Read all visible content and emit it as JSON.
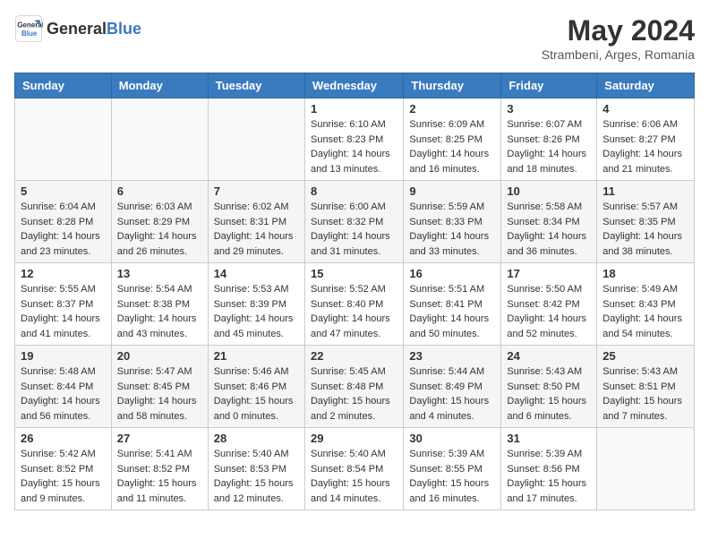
{
  "logo": {
    "text_general": "General",
    "text_blue": "Blue"
  },
  "header": {
    "month_year": "May 2024",
    "location": "Strambeni, Arges, Romania"
  },
  "weekdays": [
    "Sunday",
    "Monday",
    "Tuesday",
    "Wednesday",
    "Thursday",
    "Friday",
    "Saturday"
  ],
  "weeks": [
    [
      {
        "day": "",
        "info": ""
      },
      {
        "day": "",
        "info": ""
      },
      {
        "day": "",
        "info": ""
      },
      {
        "day": "1",
        "info": "Sunrise: 6:10 AM\nSunset: 8:23 PM\nDaylight: 14 hours and 13 minutes."
      },
      {
        "day": "2",
        "info": "Sunrise: 6:09 AM\nSunset: 8:25 PM\nDaylight: 14 hours and 16 minutes."
      },
      {
        "day": "3",
        "info": "Sunrise: 6:07 AM\nSunset: 8:26 PM\nDaylight: 14 hours and 18 minutes."
      },
      {
        "day": "4",
        "info": "Sunrise: 6:06 AM\nSunset: 8:27 PM\nDaylight: 14 hours and 21 minutes."
      }
    ],
    [
      {
        "day": "5",
        "info": "Sunrise: 6:04 AM\nSunset: 8:28 PM\nDaylight: 14 hours and 23 minutes."
      },
      {
        "day": "6",
        "info": "Sunrise: 6:03 AM\nSunset: 8:29 PM\nDaylight: 14 hours and 26 minutes."
      },
      {
        "day": "7",
        "info": "Sunrise: 6:02 AM\nSunset: 8:31 PM\nDaylight: 14 hours and 29 minutes."
      },
      {
        "day": "8",
        "info": "Sunrise: 6:00 AM\nSunset: 8:32 PM\nDaylight: 14 hours and 31 minutes."
      },
      {
        "day": "9",
        "info": "Sunrise: 5:59 AM\nSunset: 8:33 PM\nDaylight: 14 hours and 33 minutes."
      },
      {
        "day": "10",
        "info": "Sunrise: 5:58 AM\nSunset: 8:34 PM\nDaylight: 14 hours and 36 minutes."
      },
      {
        "day": "11",
        "info": "Sunrise: 5:57 AM\nSunset: 8:35 PM\nDaylight: 14 hours and 38 minutes."
      }
    ],
    [
      {
        "day": "12",
        "info": "Sunrise: 5:55 AM\nSunset: 8:37 PM\nDaylight: 14 hours and 41 minutes."
      },
      {
        "day": "13",
        "info": "Sunrise: 5:54 AM\nSunset: 8:38 PM\nDaylight: 14 hours and 43 minutes."
      },
      {
        "day": "14",
        "info": "Sunrise: 5:53 AM\nSunset: 8:39 PM\nDaylight: 14 hours and 45 minutes."
      },
      {
        "day": "15",
        "info": "Sunrise: 5:52 AM\nSunset: 8:40 PM\nDaylight: 14 hours and 47 minutes."
      },
      {
        "day": "16",
        "info": "Sunrise: 5:51 AM\nSunset: 8:41 PM\nDaylight: 14 hours and 50 minutes."
      },
      {
        "day": "17",
        "info": "Sunrise: 5:50 AM\nSunset: 8:42 PM\nDaylight: 14 hours and 52 minutes."
      },
      {
        "day": "18",
        "info": "Sunrise: 5:49 AM\nSunset: 8:43 PM\nDaylight: 14 hours and 54 minutes."
      }
    ],
    [
      {
        "day": "19",
        "info": "Sunrise: 5:48 AM\nSunset: 8:44 PM\nDaylight: 14 hours and 56 minutes."
      },
      {
        "day": "20",
        "info": "Sunrise: 5:47 AM\nSunset: 8:45 PM\nDaylight: 14 hours and 58 minutes."
      },
      {
        "day": "21",
        "info": "Sunrise: 5:46 AM\nSunset: 8:46 PM\nDaylight: 15 hours and 0 minutes."
      },
      {
        "day": "22",
        "info": "Sunrise: 5:45 AM\nSunset: 8:48 PM\nDaylight: 15 hours and 2 minutes."
      },
      {
        "day": "23",
        "info": "Sunrise: 5:44 AM\nSunset: 8:49 PM\nDaylight: 15 hours and 4 minutes."
      },
      {
        "day": "24",
        "info": "Sunrise: 5:43 AM\nSunset: 8:50 PM\nDaylight: 15 hours and 6 minutes."
      },
      {
        "day": "25",
        "info": "Sunrise: 5:43 AM\nSunset: 8:51 PM\nDaylight: 15 hours and 7 minutes."
      }
    ],
    [
      {
        "day": "26",
        "info": "Sunrise: 5:42 AM\nSunset: 8:52 PM\nDaylight: 15 hours and 9 minutes."
      },
      {
        "day": "27",
        "info": "Sunrise: 5:41 AM\nSunset: 8:52 PM\nDaylight: 15 hours and 11 minutes."
      },
      {
        "day": "28",
        "info": "Sunrise: 5:40 AM\nSunset: 8:53 PM\nDaylight: 15 hours and 12 minutes."
      },
      {
        "day": "29",
        "info": "Sunrise: 5:40 AM\nSunset: 8:54 PM\nDaylight: 15 hours and 14 minutes."
      },
      {
        "day": "30",
        "info": "Sunrise: 5:39 AM\nSunset: 8:55 PM\nDaylight: 15 hours and 16 minutes."
      },
      {
        "day": "31",
        "info": "Sunrise: 5:39 AM\nSunset: 8:56 PM\nDaylight: 15 hours and 17 minutes."
      },
      {
        "day": "",
        "info": ""
      }
    ]
  ]
}
